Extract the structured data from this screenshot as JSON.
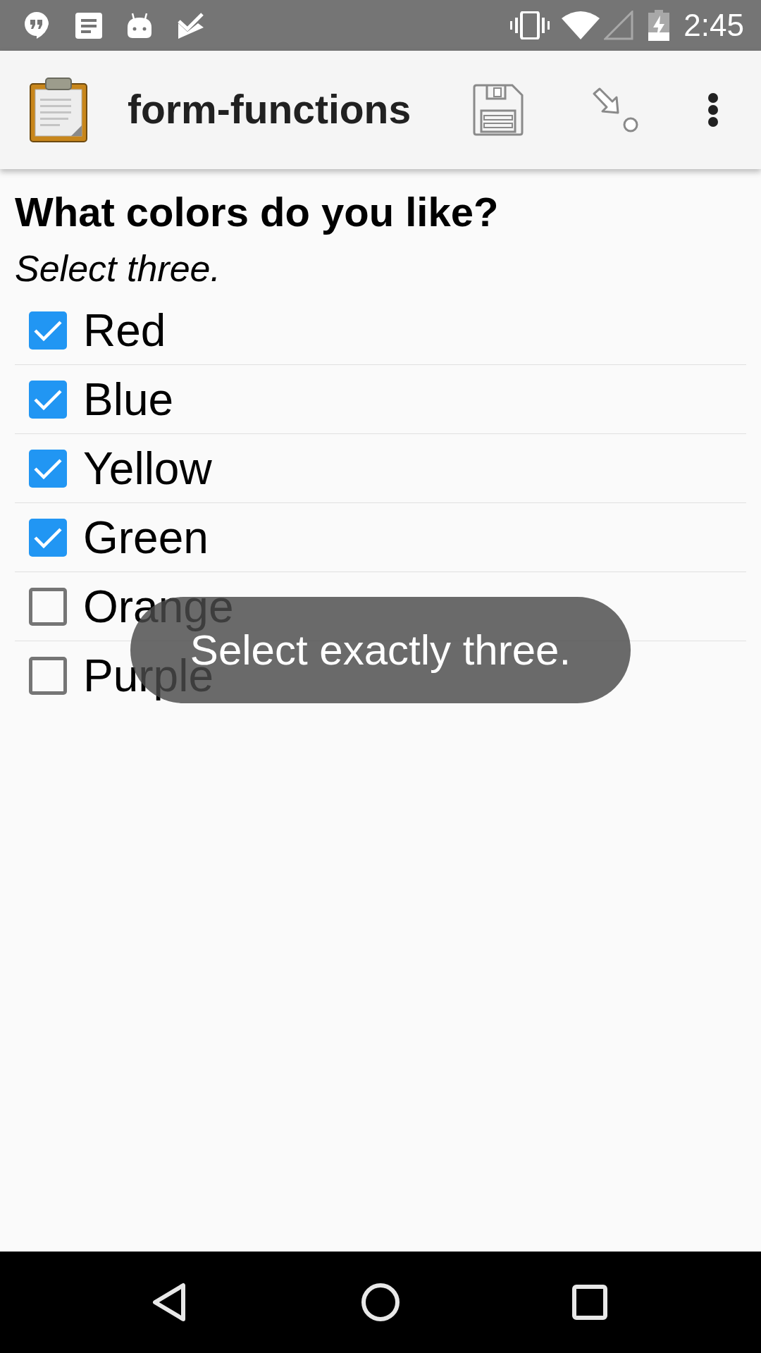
{
  "status_bar": {
    "time": "2:45"
  },
  "app_bar": {
    "title": "form-functions"
  },
  "question": {
    "label": "What colors do you like?",
    "hint": "Select three."
  },
  "options": [
    {
      "label": "Red",
      "checked": true
    },
    {
      "label": "Blue",
      "checked": true
    },
    {
      "label": "Yellow",
      "checked": true
    },
    {
      "label": "Green",
      "checked": true
    },
    {
      "label": "Orange",
      "checked": false
    },
    {
      "label": "Purple",
      "checked": false
    }
  ],
  "toast": {
    "message": "Select exactly three."
  }
}
